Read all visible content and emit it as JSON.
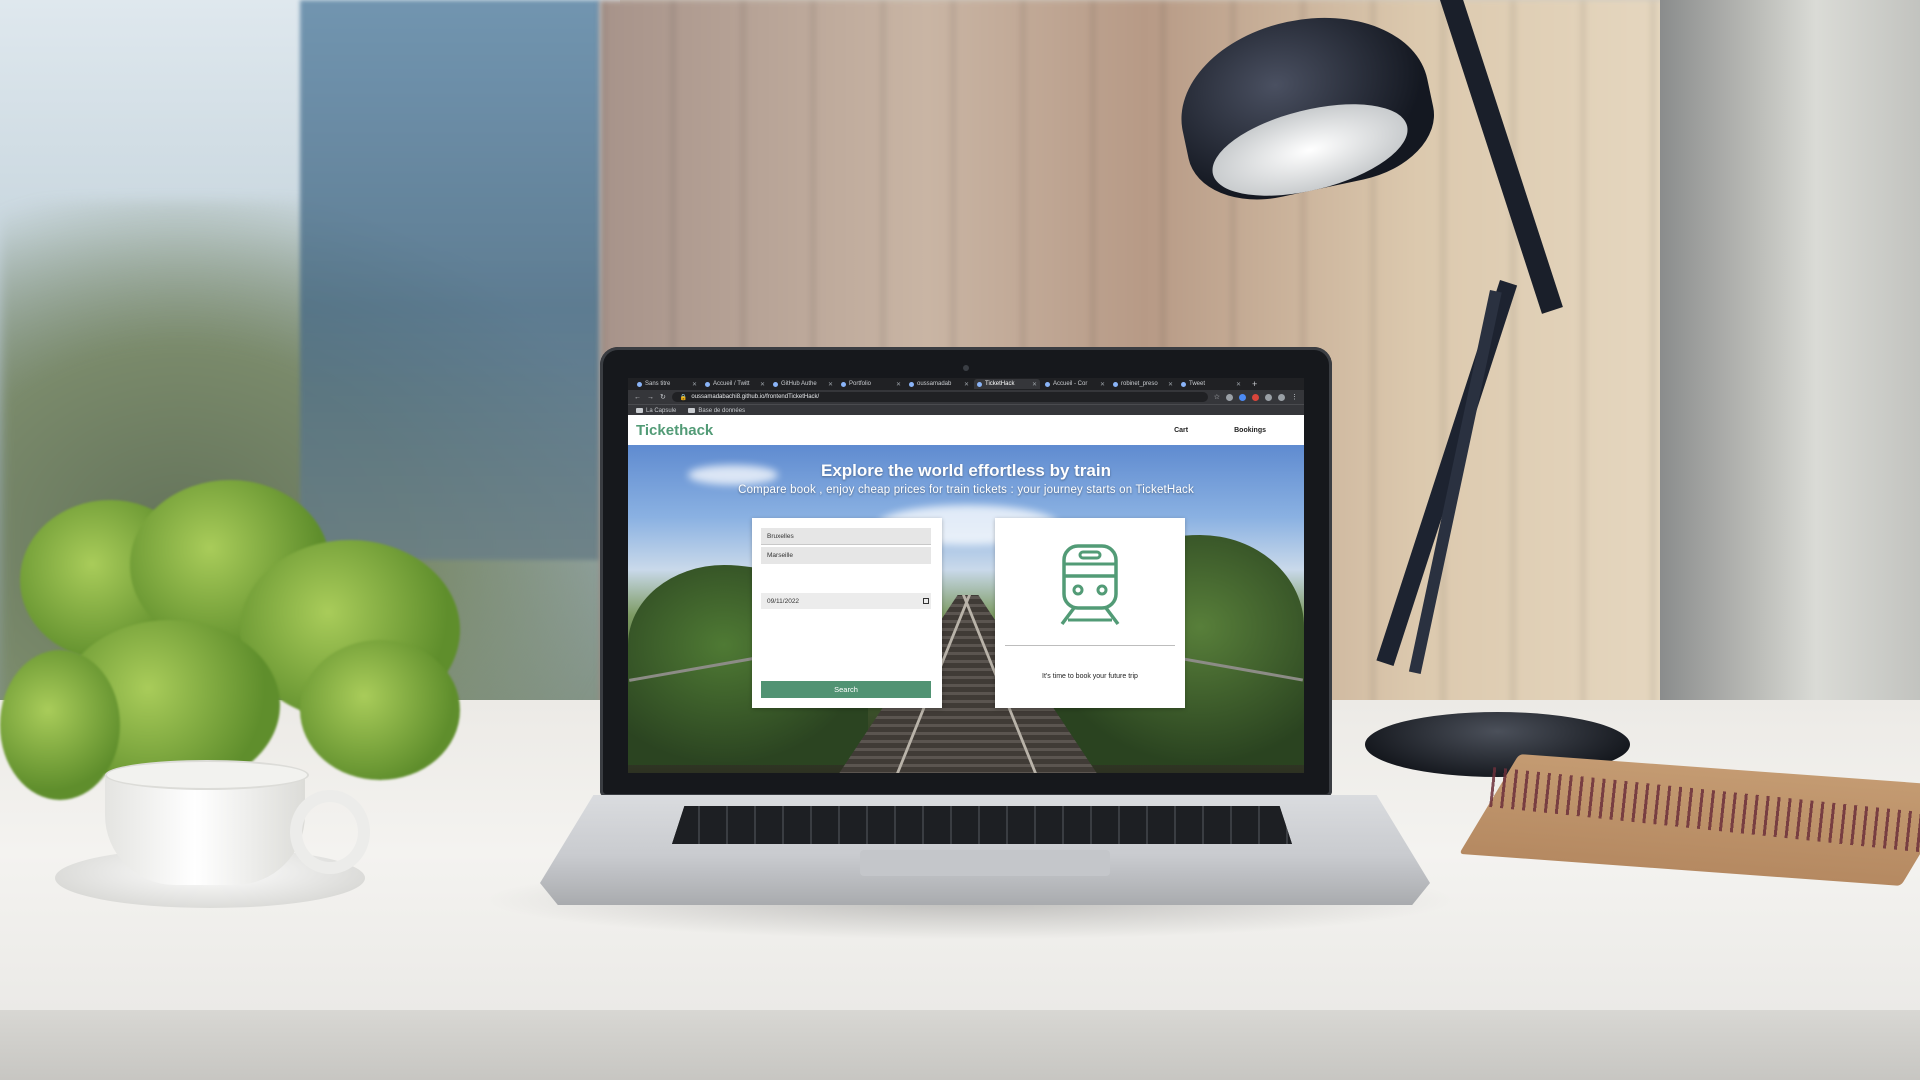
{
  "browser": {
    "tabs": [
      {
        "label": "Sans titre",
        "active": false
      },
      {
        "label": "Accueil / Twitt",
        "active": false
      },
      {
        "label": "GitHub Authe",
        "active": false
      },
      {
        "label": "Portfolio",
        "active": false
      },
      {
        "label": "oussamadab",
        "active": false
      },
      {
        "label": "TicketHack",
        "active": true
      },
      {
        "label": "Accueil - Cor",
        "active": false
      },
      {
        "label": "robinet_preso",
        "active": false
      },
      {
        "label": "Tweet",
        "active": false
      }
    ],
    "url": "oussamadabachi8.github.io/frontendTicketHack/",
    "bookmarks": [
      "La Capsule",
      "Base de données"
    ]
  },
  "header": {
    "logo": "Tickethack",
    "nav": {
      "cart": "Cart",
      "bookings": "Bookings"
    }
  },
  "hero": {
    "title": "Explore the world effortless by train",
    "subtitle": "Compare book , enjoy cheap prices for train tickets : your journey starts on TicketHack"
  },
  "search": {
    "departure": "Bruxelles",
    "arrival": "Marseille",
    "date": "09/11/2022",
    "button": "Search"
  },
  "result": {
    "message": "It's time to book your future trip"
  },
  "colors": {
    "brand_green": "#529b76",
    "button_green": "#519373"
  }
}
